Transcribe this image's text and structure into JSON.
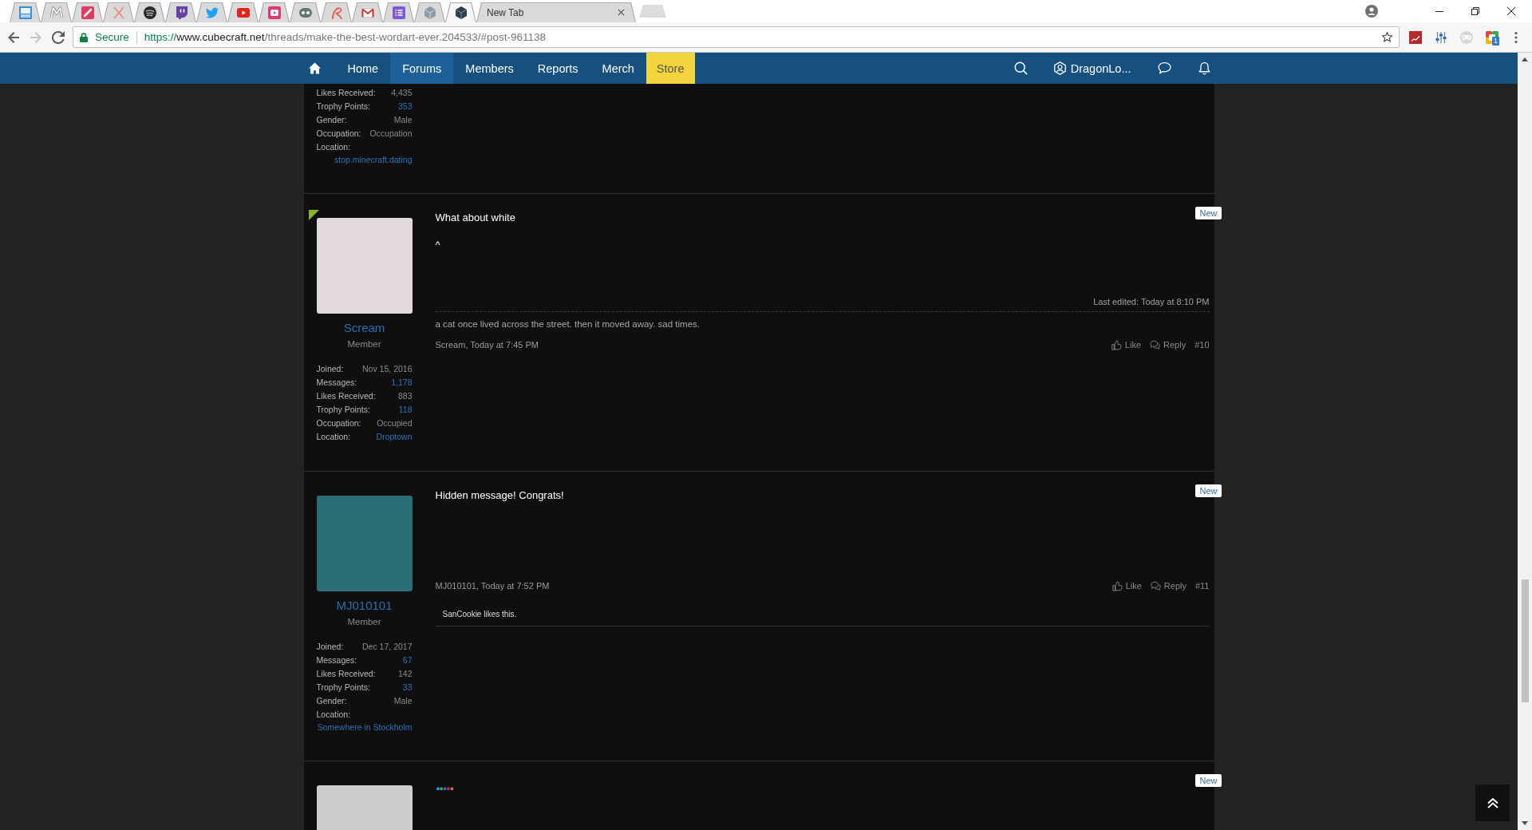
{
  "browser": {
    "tabs": [
      {
        "kind": "picture",
        "selected": false
      },
      {
        "kind": "zigzag",
        "selected": false
      },
      {
        "kind": "pen",
        "selected": false
      },
      {
        "kind": "cross",
        "selected": false
      },
      {
        "kind": "arcs",
        "selected": false
      },
      {
        "kind": "bubble",
        "selected": false
      },
      {
        "kind": "bird",
        "selected": false
      },
      {
        "kind": "play",
        "selected": false
      },
      {
        "kind": "play-square",
        "selected": false
      },
      {
        "kind": "robot",
        "selected": false
      },
      {
        "kind": "curl",
        "selected": false
      },
      {
        "kind": "mail",
        "selected": false
      },
      {
        "kind": "list",
        "selected": false
      },
      {
        "kind": "cube-light",
        "selected": false
      },
      {
        "kind": "cube-dark",
        "selected": true
      },
      {
        "kind": "page",
        "title": "New Tab",
        "selected": false
      }
    ],
    "forward_disabled": true,
    "security_label": "Secure",
    "url_parts": [
      {
        "kind": "scheme",
        "text": "https://"
      },
      {
        "kind": "host",
        "text": "www.cubecraft.net"
      },
      {
        "kind": "path",
        "text": "/threads/make-the-best-wordart-ever.204533/#post-961138"
      }
    ],
    "extension_badge": "1"
  },
  "site_nav": {
    "items": [
      {
        "kind": "home",
        "selected": false
      },
      {
        "kind": "link",
        "label": "Home",
        "selected": false
      },
      {
        "kind": "link",
        "label": "Forums",
        "selected": true
      },
      {
        "kind": "link",
        "label": "Members",
        "selected": false
      },
      {
        "kind": "link",
        "label": "Reports",
        "selected": false
      },
      {
        "kind": "link",
        "label": "Merch",
        "selected": false
      },
      {
        "kind": "store",
        "label": "Store",
        "selected": false
      }
    ],
    "username": "DragonLo..."
  },
  "posts": [
    {
      "stats": [
        {
          "label": "Likes Received:",
          "value": "4,435",
          "link": false,
          "own_line": false
        },
        {
          "label": "Trophy Points:",
          "value": "353",
          "link": true,
          "own_line": false
        },
        {
          "label": "Gender:",
          "value": "Male",
          "link": false,
          "own_line": false
        },
        {
          "label": "Occupation:",
          "value": "Occupation",
          "link": false,
          "own_line": false
        },
        {
          "label": "Location:",
          "value": "stop.minecraft.dating",
          "link": true,
          "own_line": true
        }
      ]
    },
    {
      "online": true,
      "avatar": {
        "color": "#e2d9dd"
      },
      "username": "Scream",
      "user_title": "Member",
      "stats": [
        {
          "label": "Joined:",
          "value": "Nov 15, 2016",
          "link": false,
          "own_line": false
        },
        {
          "label": "Messages:",
          "value": "1,178",
          "link": true,
          "own_line": false
        },
        {
          "label": "Likes Received:",
          "value": "883",
          "link": false,
          "own_line": false
        },
        {
          "label": "Trophy Points:",
          "value": "118",
          "link": true,
          "own_line": false
        },
        {
          "label": "Occupation:",
          "value": "Occupied",
          "link": false,
          "own_line": false
        },
        {
          "label": "Location:",
          "value": "Droptown",
          "link": true,
          "own_line": false
        }
      ],
      "badge": "New",
      "body": [
        {
          "kind": "text",
          "text": "What about white"
        },
        {
          "kind": "text",
          "text": "^"
        }
      ],
      "last_edited": "Last edited: Today at 8:10 PM",
      "signature": "a cat once lived across the street. then it moved away. sad times.",
      "byline": "Scream, Today at 7:45 PM",
      "actions": {
        "like": "Like",
        "reply": "Reply",
        "number": "#10"
      }
    },
    {
      "online": false,
      "avatar": {
        "color": "#2b6e78"
      },
      "username": "MJ010101",
      "user_title": "Member",
      "stats": [
        {
          "label": "Joined:",
          "value": "Dec 17, 2017",
          "link": false,
          "own_line": false
        },
        {
          "label": "Messages:",
          "value": "67",
          "link": true,
          "own_line": false
        },
        {
          "label": "Likes Received:",
          "value": "142",
          "link": false,
          "own_line": false
        },
        {
          "label": "Trophy Points:",
          "value": "33",
          "link": true,
          "own_line": false
        },
        {
          "label": "Gender:",
          "value": "Male",
          "link": false,
          "own_line": false
        },
        {
          "label": "Location:",
          "value": "Somewhere in Stockholm",
          "link": true,
          "own_line": true
        }
      ],
      "badge": "New",
      "body": [
        {
          "kind": "text",
          "text": "Hidden message! Congrats!"
        }
      ],
      "byline": "MJ010101, Today at 7:52 PM",
      "actions": {
        "like": "Like",
        "reply": "Reply",
        "number": "#11"
      },
      "likes": "SanCookie likes this."
    },
    {
      "online": false,
      "avatar": {
        "color": "#cdcdcd"
      },
      "badge": "New",
      "body": [
        {
          "kind": "dots",
          "chars": [
            {
              "text": ".",
              "color": "#3fa2e0"
            },
            {
              "text": ".",
              "color": "#37b84c"
            },
            {
              "text": ".",
              "color": "#3c6fd6"
            },
            {
              "text": ".",
              "color": "#e0206c"
            },
            {
              "text": ".",
              "color": "#d27f1e"
            }
          ]
        }
      ]
    }
  ]
}
